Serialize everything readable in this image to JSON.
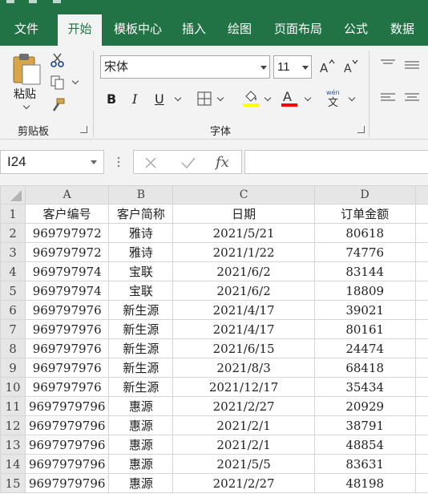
{
  "ribbon_tabs": [
    {
      "label": "文件",
      "active": false
    },
    {
      "label": "开始",
      "active": true
    },
    {
      "label": "模板中心",
      "active": false
    },
    {
      "label": "插入",
      "active": false
    },
    {
      "label": "绘图",
      "active": false
    },
    {
      "label": "页面布局",
      "active": false
    },
    {
      "label": "公式",
      "active": false
    },
    {
      "label": "数据",
      "active": false
    }
  ],
  "clipboard": {
    "paste_label": "粘贴",
    "group_label": "剪贴板"
  },
  "font": {
    "name": "宋体",
    "size": "11",
    "group_label": "字体",
    "bold": "B",
    "italic": "I",
    "underline": "U",
    "phonetic": "wén\n文"
  },
  "colors": {
    "accent": "#217346",
    "highlight": "#ffff00",
    "font_color": "#ff0000"
  },
  "formula_bar": {
    "name_box": "I24",
    "formula": ""
  },
  "columns": [
    "A",
    "B",
    "C",
    "D"
  ],
  "rows": [
    {
      "n": "1",
      "cells": [
        "客户编号",
        "客户简称",
        "日期",
        "订单金额"
      ]
    },
    {
      "n": "2",
      "cells": [
        "969797972",
        "雅诗",
        "2021/5/21",
        "80618"
      ]
    },
    {
      "n": "3",
      "cells": [
        "969797972",
        "雅诗",
        "2021/1/22",
        "74776"
      ]
    },
    {
      "n": "4",
      "cells": [
        "969797974",
        "宝联",
        "2021/6/2",
        "83144"
      ]
    },
    {
      "n": "5",
      "cells": [
        "969797974",
        "宝联",
        "2021/6/2",
        "18809"
      ]
    },
    {
      "n": "6",
      "cells": [
        "969797976",
        "新生源",
        "2021/4/17",
        "39021"
      ]
    },
    {
      "n": "7",
      "cells": [
        "969797976",
        "新生源",
        "2021/4/17",
        "80161"
      ]
    },
    {
      "n": "8",
      "cells": [
        "969797976",
        "新生源",
        "2021/6/15",
        "24474"
      ]
    },
    {
      "n": "9",
      "cells": [
        "969797976",
        "新生源",
        "2021/8/3",
        "68418"
      ]
    },
    {
      "n": "10",
      "cells": [
        "969797976",
        "新生源",
        "2021/12/17",
        "35434"
      ]
    },
    {
      "n": "11",
      "cells": [
        "9697979796",
        "惠源",
        "2021/2/27",
        "20929"
      ]
    },
    {
      "n": "12",
      "cells": [
        "9697979796",
        "惠源",
        "2021/2/1",
        "38791"
      ]
    },
    {
      "n": "13",
      "cells": [
        "9697979796",
        "惠源",
        "2021/2/1",
        "48854"
      ]
    },
    {
      "n": "14",
      "cells": [
        "9697979796",
        "惠源",
        "2021/5/5",
        "83631"
      ]
    },
    {
      "n": "15",
      "cells": [
        "9697979796",
        "惠源",
        "2021/2/27",
        "48198"
      ]
    }
  ]
}
